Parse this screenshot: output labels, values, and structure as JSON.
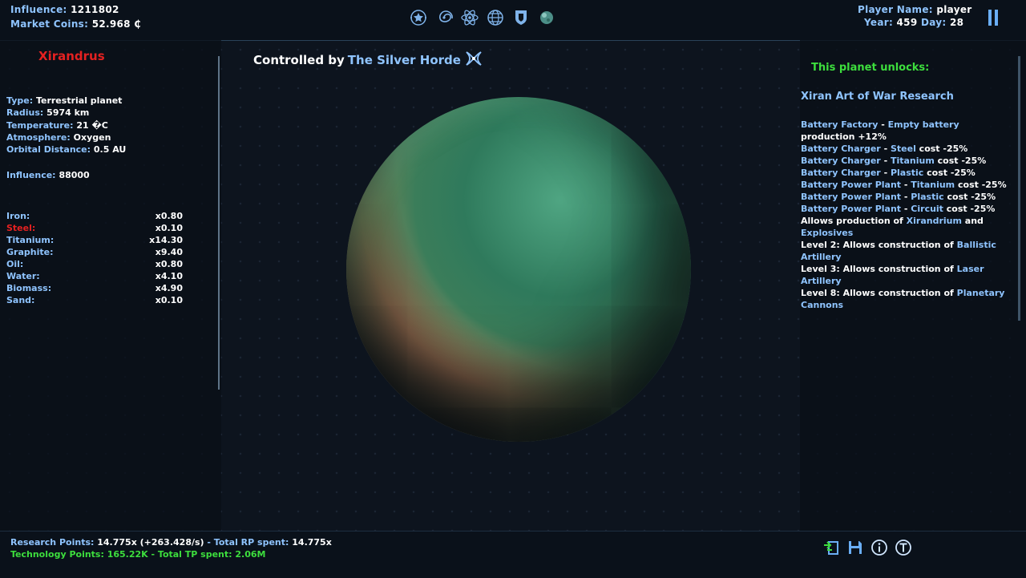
{
  "topbar": {
    "influence_label": "Influence:",
    "influence_value": "1211802",
    "coins_label": "Market Coins:",
    "coins_value": "52.968 ₵",
    "player_label": "Player Name:",
    "player_value": "player",
    "year_label": "Year:",
    "year_value": "459",
    "day_label": "Day:",
    "day_value": "28",
    "nav_icons": [
      "star-badge-icon",
      "galaxy-icon",
      "atom-icon",
      "globe-icon",
      "shield-icon",
      "planet-icon"
    ]
  },
  "planet": {
    "name": "Xirandrus",
    "type_label": "Type:",
    "type_value": "Terrestrial planet",
    "radius_label": "Radius:",
    "radius_value": "5974 km",
    "temp_label": "Temperature:",
    "temp_value": "21 �C",
    "atmo_label": "Atmosphere:",
    "atmo_value": "Oxygen",
    "orbit_label": "Orbital Distance:",
    "orbit_value": "0.5 AU",
    "influence_label": "Influence:",
    "influence_value": "88000",
    "resources": [
      {
        "name": "Iron:",
        "mult": "x0.80"
      },
      {
        "name": "Steel:",
        "mult": "x0.10"
      },
      {
        "name": "Titanium:",
        "mult": "x14.30"
      },
      {
        "name": "Graphite:",
        "mult": "x9.40"
      },
      {
        "name": "Oil:",
        "mult": "x0.80"
      },
      {
        "name": "Water:",
        "mult": "x4.10"
      },
      {
        "name": "Biomass:",
        "mult": "x4.90"
      },
      {
        "name": "Sand:",
        "mult": "x0.10"
      }
    ]
  },
  "control": {
    "prefix": "Controlled by",
    "faction": "The Silver Horde"
  },
  "unlocks": {
    "title": "This planet unlocks:",
    "research": "Xiran Art of War Research",
    "items": [
      {
        "a": "Battery Factory",
        "sep": " - ",
        "b": "Empty battery",
        "c": ""
      },
      {
        "a": "",
        "sep": "",
        "b": "",
        "c": "production +12%"
      },
      {
        "a": "Battery Charger",
        "sep": " - ",
        "b": "Steel",
        "c": " cost -25%"
      },
      {
        "a": "Battery Charger",
        "sep": " - ",
        "b": "Titanium",
        "c": " cost -25%"
      },
      {
        "a": "Battery Charger",
        "sep": " - ",
        "b": "Plastic",
        "c": " cost -25%"
      },
      {
        "a": "Battery Power Plant",
        "sep": " - ",
        "b": "Titanium",
        "c": " cost -25%"
      },
      {
        "a": "Battery Power Plant",
        "sep": " - ",
        "b": "Plastic",
        "c": " cost -25%"
      },
      {
        "a": "Battery Power Plant",
        "sep": " - ",
        "b": "Circuit",
        "c": " cost -25%"
      },
      {
        "a": "",
        "sep": "",
        "b": "",
        "c": "Allows production of ",
        "d": "Xirandrium",
        "e": " and"
      },
      {
        "a": "Explosives",
        "sep": "",
        "b": "",
        "c": ""
      },
      {
        "a": "",
        "sep": "",
        "b": "",
        "c": "Level 2: Allows construction of ",
        "d": "Ballistic",
        "e": ""
      },
      {
        "a": "Artillery",
        "sep": "",
        "b": "",
        "c": ""
      },
      {
        "a": "",
        "sep": "",
        "b": "",
        "c": "Level 3: Allows construction of ",
        "d": "Laser",
        "e": ""
      },
      {
        "a": "Artillery",
        "sep": "",
        "b": "",
        "c": ""
      },
      {
        "a": "",
        "sep": "",
        "b": "",
        "c": "Level 8: Allows construction of ",
        "d": "Planetary",
        "e": ""
      },
      {
        "a": "Cannons",
        "sep": "",
        "b": "",
        "c": ""
      }
    ]
  },
  "bottombar": {
    "rp_label": "Research Points:",
    "rp_value": "14.775x (+263.428/s)",
    "rp_sep": " - ",
    "rp_total_label": "Total RP spent:",
    "rp_total_value": "14.775x",
    "tp_text": "Technology Points: 165.22K - Total TP spent: 2.06M",
    "icons": [
      "swap-icon",
      "save-icon",
      "info-icon",
      "tech-icon"
    ]
  },
  "colors": {
    "accent_blue": "#8fc4ff",
    "accent_green": "#3dde3d",
    "accent_red": "#e52121",
    "background": "#0b121c"
  }
}
